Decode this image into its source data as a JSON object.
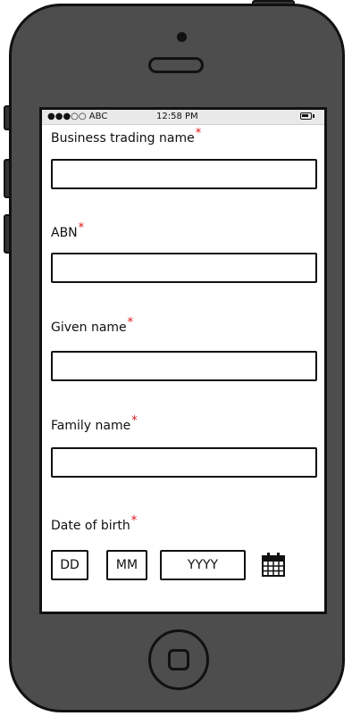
{
  "status_bar": {
    "carrier": "●●●○○ ABC",
    "time": "12:58 PM"
  },
  "form": {
    "business_trading_name": {
      "label": "Business trading name",
      "required_mark": "*",
      "value": ""
    },
    "abn": {
      "label": "ABN",
      "required_mark": "*",
      "value": ""
    },
    "given_name": {
      "label": "Given name",
      "required_mark": "*",
      "value": ""
    },
    "family_name": {
      "label": "Family name",
      "required_mark": "*",
      "value": ""
    },
    "date_of_birth": {
      "label": "Date of birth",
      "required_mark": "*",
      "day_placeholder": "DD",
      "month_placeholder": "MM",
      "year_placeholder": "YYYY"
    }
  },
  "colors": {
    "required": "#dd1111",
    "phone_body": "#4d4d4d"
  },
  "icons": {
    "calendar": "calendar-icon",
    "battery": "battery-icon"
  }
}
